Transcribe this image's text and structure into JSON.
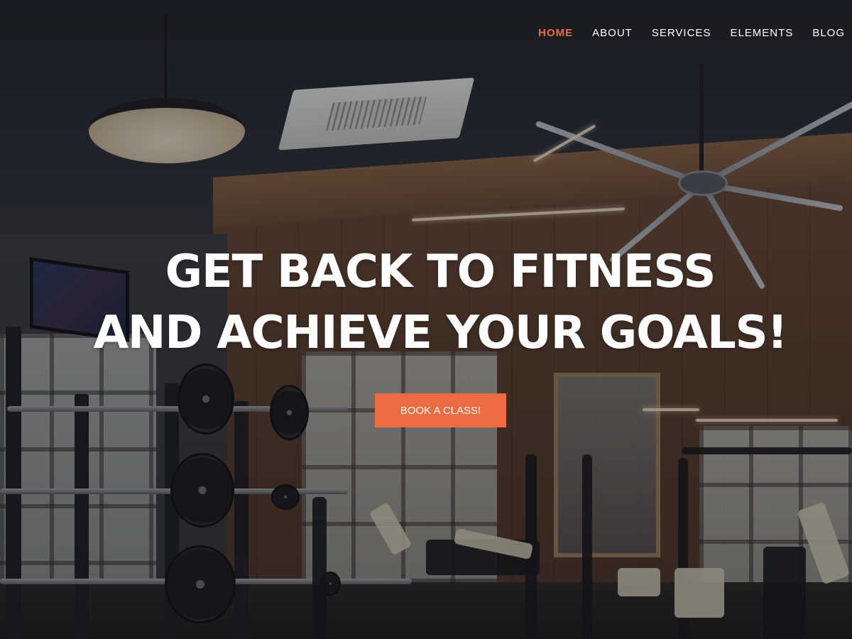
{
  "nav": {
    "items": [
      {
        "label": "HOME",
        "active": true
      },
      {
        "label": "ABOUT",
        "active": false
      },
      {
        "label": "SERVICES",
        "active": false
      },
      {
        "label": "ELEMENTS",
        "active": false
      },
      {
        "label": "BLOG",
        "active": false
      }
    ]
  },
  "hero": {
    "headline_line1": "GET BACK TO FITNESS",
    "headline_line2": "AND ACHIEVE YOUR GOALS!",
    "cta_label": "BOOK A CLASS!",
    "background_image": "gym-interior-photo"
  },
  "colors": {
    "accent": "#ee6b41",
    "text": "#ffffff"
  }
}
